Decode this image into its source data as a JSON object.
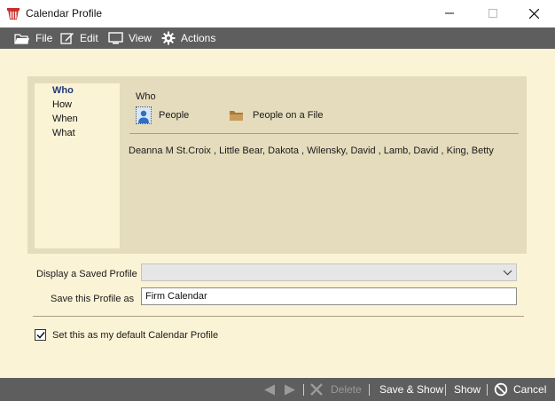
{
  "window": {
    "title": "Calendar Profile",
    "min_glyph": "—",
    "max_glyph": "☐",
    "close_glyph": "✕"
  },
  "menu": {
    "file": "File",
    "edit": "Edit",
    "view": "View",
    "actions": "Actions"
  },
  "nav": {
    "items": [
      "Who",
      "How",
      "When",
      "What"
    ],
    "active": "Who"
  },
  "who": {
    "heading": "Who",
    "people_button": "People",
    "people_on_file_button": "People on a File",
    "people_list": "Deanna M St.Croix ,  Little Bear, Dakota ,  Wilensky, David ,  Lamb, David ,  King, Betty"
  },
  "profile": {
    "display_label": "Display a Saved Profile",
    "display_value": "",
    "save_label": "Save this Profile as",
    "save_value": "Firm Calendar"
  },
  "default_checkbox": {
    "label": "Set this as my default Calendar Profile",
    "checked": true
  },
  "footer": {
    "delete": "Delete",
    "save_show": "Save & Show",
    "show": "Show",
    "cancel": "Cancel"
  },
  "colors": {
    "background": "#fbf3d6",
    "panel": "#e4dcbc",
    "bar": "#5e5e5e",
    "accent_title": "#1f3a7a",
    "folder": "#b58a4c"
  }
}
